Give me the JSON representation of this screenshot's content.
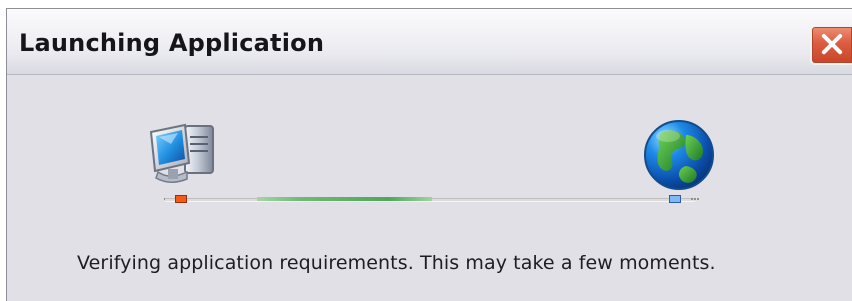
{
  "window": {
    "title": "Launching Application"
  },
  "controls": {
    "close_icon": "close-icon",
    "close_color": "#d6563b"
  },
  "content": {
    "status_message": "Verifying application requirements. This may take a few moments.",
    "left_icon": "computer-icon",
    "right_icon": "globe-icon",
    "progress_state": "in-progress"
  },
  "colors": {
    "progress_green": "#4da859",
    "left_connector": "#f45b14",
    "right_connector": "#7eb8f8"
  }
}
